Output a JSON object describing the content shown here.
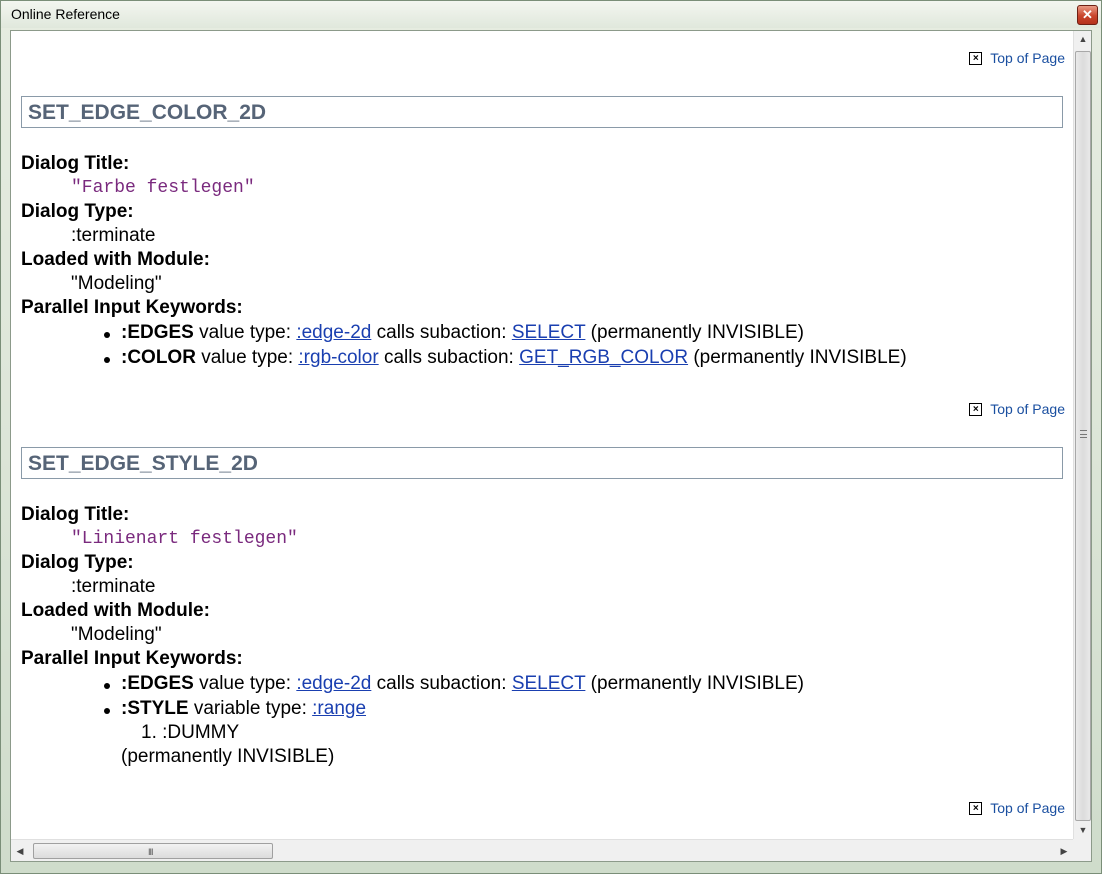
{
  "window": {
    "title": "Online Reference",
    "close_glyph": "✕"
  },
  "top_link": "Top of Page",
  "sections": [
    {
      "heading": "SET_EDGE_COLOR_2D",
      "dialog_title_label": "Dialog Title:",
      "dialog_title": "\"Farbe festlegen\"",
      "dialog_type_label": "Dialog Type:",
      "dialog_type": ":terminate",
      "module_label": "Loaded with Module:",
      "module": "\"Modeling\"",
      "keywords_label": "Parallel Input Keywords:",
      "keywords": [
        {
          "kw": ":EDGES",
          "t1": "value type:",
          "type_link": ":edge-2d",
          "t2": "calls subaction:",
          "sub_link": "SELECT",
          "tail": "(permanently INVISIBLE)"
        },
        {
          "kw": ":COLOR",
          "t1": "value type:",
          "type_link": ":rgb-color",
          "t2": "calls subaction:",
          "sub_link": "GET_RGB_COLOR",
          "tail": "(permanently INVISIBLE)"
        }
      ]
    },
    {
      "heading": "SET_EDGE_STYLE_2D",
      "dialog_title_label": "Dialog Title:",
      "dialog_title": "\"Linienart festlegen\"",
      "dialog_type_label": "Dialog Type:",
      "dialog_type": ":terminate",
      "module_label": "Loaded with Module:",
      "module": "\"Modeling\"",
      "keywords_label": "Parallel Input Keywords:",
      "keywords": [
        {
          "kw": ":EDGES",
          "t1": "value type:",
          "type_link": ":edge-2d",
          "t2": "calls subaction:",
          "sub_link": "SELECT",
          "tail": "(permanently INVISIBLE)"
        },
        {
          "kw": ":STYLE",
          "t1": "variable type:",
          "type_link": ":range"
        }
      ],
      "range_items": [
        "1.  :DUMMY"
      ],
      "range_note": "(permanently INVISIBLE)"
    }
  ],
  "scrollbar_glyphs": {
    "up": "▲",
    "down": "▼",
    "left": "◀",
    "right": "▶",
    "grip": "III"
  }
}
